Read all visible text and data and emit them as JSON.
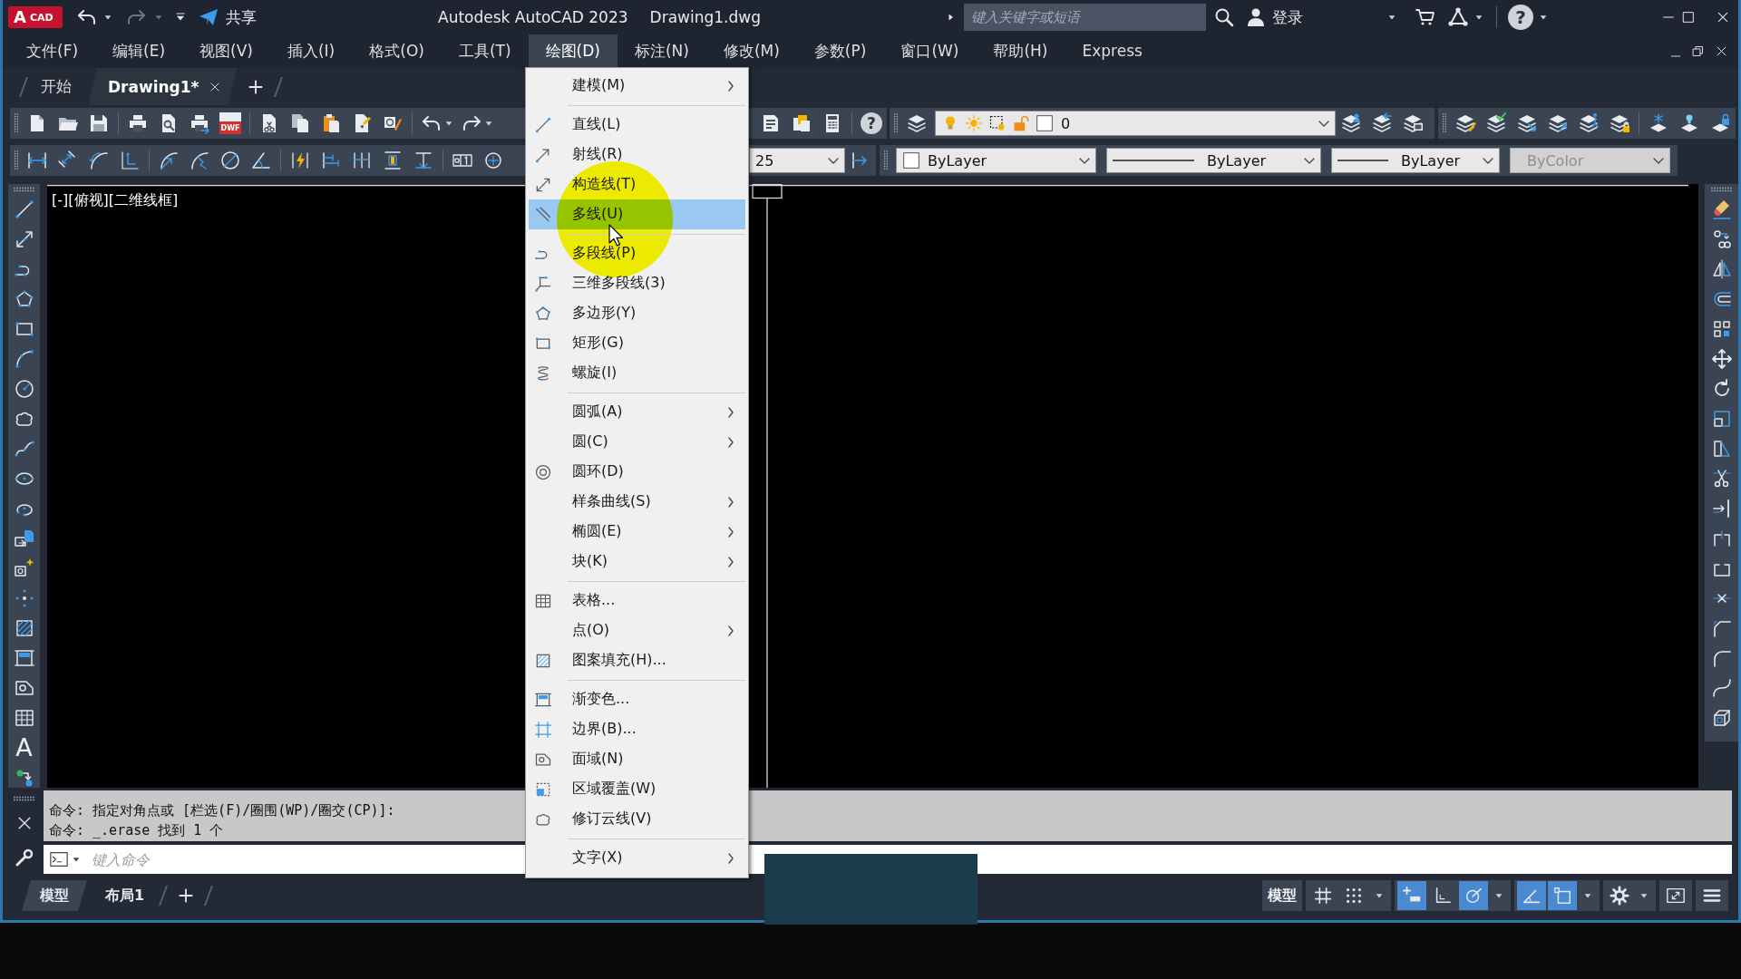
{
  "window": {
    "title": "Autodesk AutoCAD 2023",
    "document": "Drawing1.dwg"
  },
  "app_logo": {
    "letter": "A",
    "label": "CAD"
  },
  "quick_access": {
    "share_label": "共享",
    "redo_enabled": false
  },
  "search": {
    "placeholder": "键入关键字或短语"
  },
  "account": {
    "sign_in": "登录",
    "help_label": "?"
  },
  "menu_bar": [
    {
      "label": "文件(F)",
      "selected": false
    },
    {
      "label": "编辑(E)",
      "selected": false
    },
    {
      "label": "视图(V)",
      "selected": false
    },
    {
      "label": "插入(I)",
      "selected": false
    },
    {
      "label": "格式(O)",
      "selected": false
    },
    {
      "label": "工具(T)",
      "selected": false
    },
    {
      "label": "绘图(D)",
      "selected": true
    },
    {
      "label": "标注(N)",
      "selected": false
    },
    {
      "label": "修改(M)",
      "selected": false
    },
    {
      "label": "参数(P)",
      "selected": false
    },
    {
      "label": "窗口(W)",
      "selected": false
    },
    {
      "label": "帮助(H)",
      "selected": false
    },
    {
      "label": "Express",
      "selected": false
    }
  ],
  "doc_tabs": [
    {
      "label": "开始",
      "selected": false,
      "closable": false
    },
    {
      "label": "Drawing1*",
      "selected": true,
      "closable": true
    }
  ],
  "standard_toolbar": {
    "dwf_label": "DWF",
    "help_label": "?"
  },
  "layers_toolbar": {
    "current_layer": "0"
  },
  "properties_toolbar": {
    "dimension_style": "25",
    "color_control": "ByLayer",
    "linetype": "ByLayer",
    "lineweight": "ByLayer",
    "plot_style": {
      "value": "ByColor",
      "disabled": true
    }
  },
  "draw_toolbar": {
    "text_label": "A"
  },
  "viewport": {
    "label": "[-][俯视][二维线框]"
  },
  "draw_menu": {
    "groups": [
      [
        {
          "label": "建模(M)",
          "submenu": true,
          "selected": false
        }
      ],
      [
        {
          "label": "直线(L)",
          "submenu": false,
          "selected": false
        },
        {
          "label": "射线(R)",
          "submenu": false,
          "selected": false
        },
        {
          "label": "构造线(T)",
          "submenu": false,
          "selected": false
        },
        {
          "label": "多线(U)",
          "submenu": false,
          "selected": true
        }
      ],
      [
        {
          "label": "多段线(P)",
          "submenu": false,
          "selected": false
        },
        {
          "label": "三维多段线(3)",
          "submenu": false,
          "selected": false
        },
        {
          "label": "多边形(Y)",
          "submenu": false,
          "selected": false
        },
        {
          "label": "矩形(G)",
          "submenu": false,
          "selected": false
        },
        {
          "label": "螺旋(I)",
          "submenu": false,
          "selected": false
        }
      ],
      [
        {
          "label": "圆弧(A)",
          "submenu": true,
          "selected": false
        },
        {
          "label": "圆(C)",
          "submenu": true,
          "selected": false
        },
        {
          "label": "圆环(D)",
          "submenu": false,
          "selected": false
        },
        {
          "label": "样条曲线(S)",
          "submenu": true,
          "selected": false
        },
        {
          "label": "椭圆(E)",
          "submenu": true,
          "selected": false
        },
        {
          "label": "块(K)",
          "submenu": true,
          "selected": false
        }
      ],
      [
        {
          "label": "表格...",
          "submenu": false,
          "selected": false
        },
        {
          "label": "点(O)",
          "submenu": true,
          "selected": false
        },
        {
          "label": "图案填充(H)...",
          "submenu": false,
          "selected": false
        }
      ],
      [
        {
          "label": "渐变色...",
          "submenu": false,
          "selected": false
        },
        {
          "label": "边界(B)...",
          "submenu": false,
          "selected": false
        },
        {
          "label": "面域(N)",
          "submenu": false,
          "selected": false
        },
        {
          "label": "区域覆盖(W)",
          "submenu": false,
          "selected": false
        },
        {
          "label": "修订云线(V)",
          "submenu": false,
          "selected": false
        }
      ],
      [
        {
          "label": "文字(X)",
          "submenu": true,
          "selected": false
        }
      ]
    ]
  },
  "command_line": {
    "history": [
      "命令: 指定对角点或 [栏选(F)/圈围(WP)/圈交(CP)]:",
      "命令: _.erase 找到 1 个"
    ],
    "placeholder": "键入命令"
  },
  "layout_tabs": [
    {
      "label": "模型",
      "selected": true
    },
    {
      "label": "布局1",
      "selected": false
    }
  ],
  "status_bar": {
    "model_label": "模型",
    "toggles": [
      {
        "on": false
      },
      {
        "on": false
      },
      {
        "on": true
      },
      {
        "on": false
      },
      {
        "on": true
      },
      {
        "on": true
      },
      {
        "on": true
      }
    ]
  }
}
